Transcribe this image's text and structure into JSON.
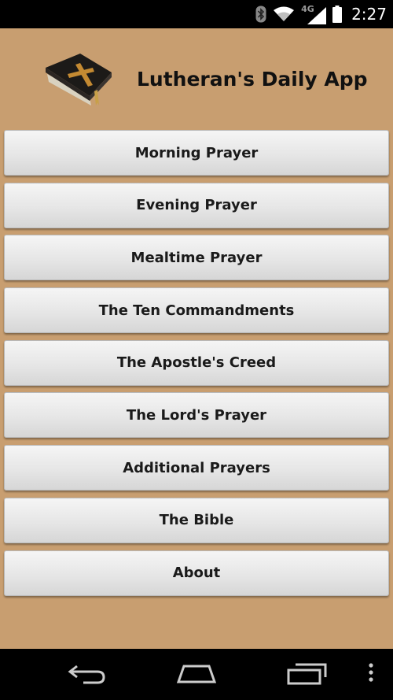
{
  "status_bar": {
    "time": "2:27",
    "network_label": "4G",
    "icons": [
      "bluetooth-icon",
      "wifi-icon",
      "signal-icon",
      "battery-icon"
    ]
  },
  "app": {
    "title": "Lutheran's Daily App",
    "background_color": "#c89e70"
  },
  "menu": {
    "items": [
      {
        "label": "Morning Prayer"
      },
      {
        "label": "Evening Prayer"
      },
      {
        "label": "Mealtime Prayer"
      },
      {
        "label": "The Ten Commandments"
      },
      {
        "label": "The Apostle's Creed"
      },
      {
        "label": "The Lord's Prayer"
      },
      {
        "label": "Additional Prayers"
      },
      {
        "label": "The Bible"
      },
      {
        "label": "About"
      }
    ]
  },
  "nav_bar": {
    "icons": [
      "back-icon",
      "home-icon",
      "recent-apps-icon",
      "overflow-menu-icon"
    ]
  }
}
